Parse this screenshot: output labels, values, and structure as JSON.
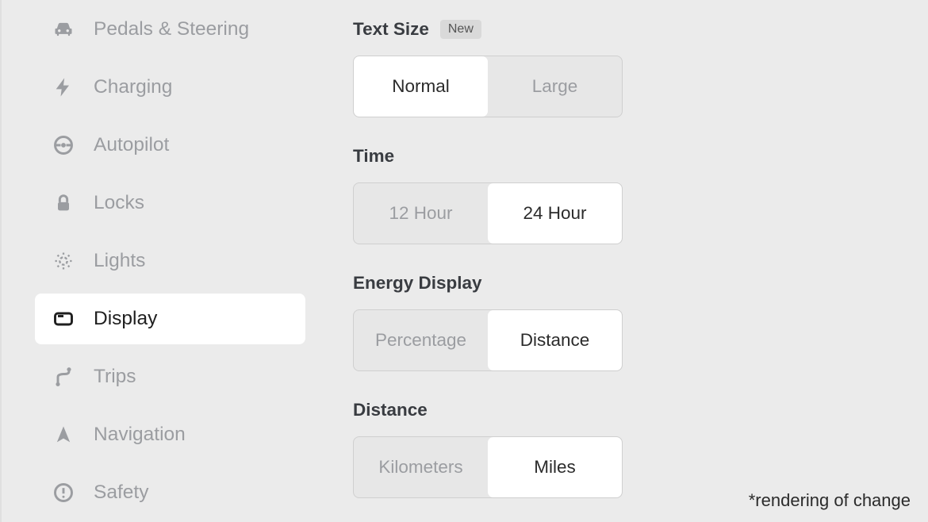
{
  "sidebar": {
    "items": [
      {
        "label": "Pedals & Steering",
        "icon": "car",
        "active": false
      },
      {
        "label": "Charging",
        "icon": "bolt",
        "active": false
      },
      {
        "label": "Autopilot",
        "icon": "wheel",
        "active": false
      },
      {
        "label": "Locks",
        "icon": "lock",
        "active": false
      },
      {
        "label": "Lights",
        "icon": "light",
        "active": false
      },
      {
        "label": "Display",
        "icon": "display",
        "active": true
      },
      {
        "label": "Trips",
        "icon": "trips",
        "active": false
      },
      {
        "label": "Navigation",
        "icon": "nav",
        "active": false
      },
      {
        "label": "Safety",
        "icon": "safety",
        "active": false
      }
    ]
  },
  "settings": {
    "text_size": {
      "label": "Text Size",
      "badge": "New",
      "options": [
        "Normal",
        "Large"
      ],
      "selected": "Normal"
    },
    "time": {
      "label": "Time",
      "options": [
        "12 Hour",
        "24 Hour"
      ],
      "selected": "24 Hour"
    },
    "energy_display": {
      "label": "Energy Display",
      "options": [
        "Percentage",
        "Distance"
      ],
      "selected": "Distance"
    },
    "distance": {
      "label": "Distance",
      "options": [
        "Kilometers",
        "Miles"
      ],
      "selected": "Miles"
    }
  },
  "footnote": "*rendering of change"
}
